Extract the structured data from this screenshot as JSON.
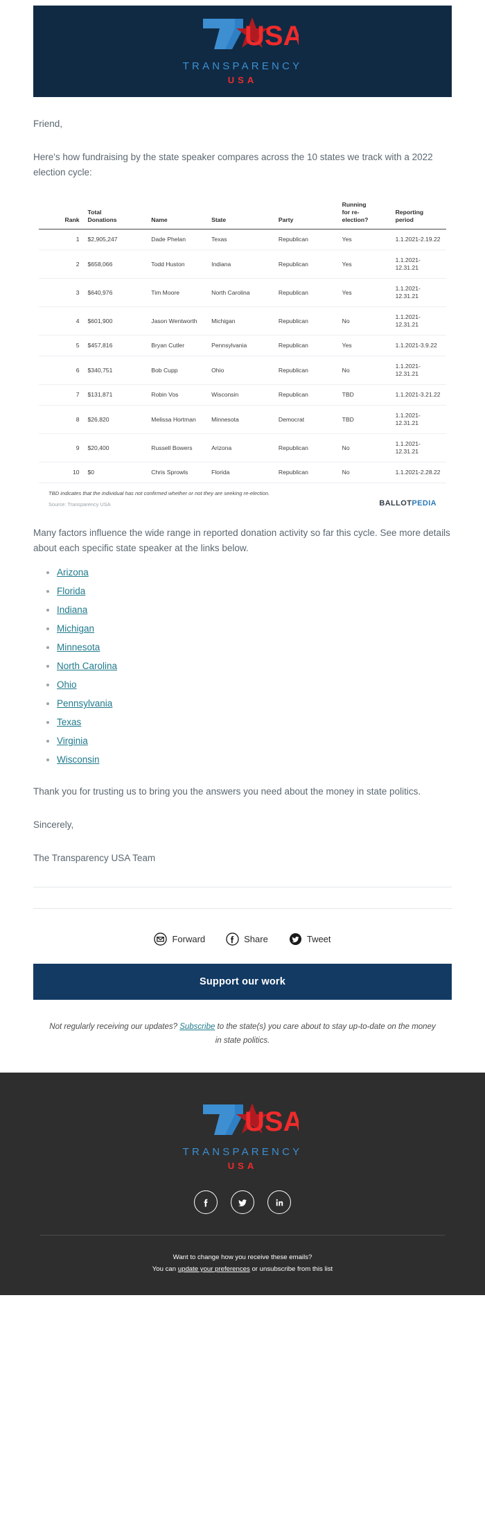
{
  "brand": {
    "name": "T USA",
    "wordmark": "TRANSPARENCY",
    "usa": "USA",
    "hero_bg": "#102a43",
    "blue": "#3d8fd1",
    "red": "#ef2b2b",
    "footer_bg": "#2e2e2e"
  },
  "body": {
    "greeting": "Friend,",
    "intro": "Here's how fundraising by the state speaker compares across the 10 states we track with a 2022 election cycle:",
    "after_table": "Many factors influence the wide range in reported donation activity so far this cycle. See more details about each specific state speaker at the links below.",
    "thanks": "Thank you for trusting us to bring you the answers you need about the money in state politics.",
    "signoff": "Sincerely,",
    "team": "The Transparency USA Team"
  },
  "table": {
    "columns": [
      "Rank",
      "Total Donations",
      "Name",
      "State",
      "Party",
      "Running for re-election?",
      "Reporting period"
    ],
    "columns_split": [
      [
        "Rank"
      ],
      [
        "Total",
        "Donations"
      ],
      [
        "Name"
      ],
      [
        "State"
      ],
      [
        "Party"
      ],
      [
        "Running",
        "for re-",
        "election?"
      ],
      [
        "Reporting",
        "period"
      ]
    ],
    "rows": [
      {
        "rank": "1",
        "amount": "$2,905,247",
        "name": "Dade Phelan",
        "state": "Texas",
        "party": "Republican",
        "reelection": "Yes",
        "period": "1.1.2021-2.19.22"
      },
      {
        "rank": "2",
        "amount": "$658,066",
        "name": "Todd Huston",
        "state": "Indiana",
        "party": "Republican",
        "reelection": "Yes",
        "period": "1.1.2021-12.31.21"
      },
      {
        "rank": "3",
        "amount": "$640,976",
        "name": "Tim Moore",
        "state": "North Carolina",
        "party": "Republican",
        "reelection": "Yes",
        "period": "1.1.2021-12.31.21"
      },
      {
        "rank": "4",
        "amount": "$601,900",
        "name": "Jason Wentworth",
        "state": "Michigan",
        "party": "Republican",
        "reelection": "No",
        "period": "1.1.2021-12.31.21"
      },
      {
        "rank": "5",
        "amount": "$457,816",
        "name": "Bryan Cutler",
        "state": "Pennsylvania",
        "party": "Republican",
        "reelection": "Yes",
        "period": "1.1.2021-3.9.22"
      },
      {
        "rank": "6",
        "amount": "$340,751",
        "name": "Bob Cupp",
        "state": "Ohio",
        "party": "Republican",
        "reelection": "No",
        "period": "1.1.2021-12.31.21"
      },
      {
        "rank": "7",
        "amount": "$131,871",
        "name": "Robin Vos",
        "state": "Wisconsin",
        "party": "Republican",
        "reelection": "TBD",
        "period": "1.1.2021-3.21.22"
      },
      {
        "rank": "8",
        "amount": "$26,820",
        "name": "Melissa Hortman",
        "state": "Minnesota",
        "party": "Democrat",
        "reelection": "TBD",
        "period": "1.1.2021-12.31.21"
      },
      {
        "rank": "9",
        "amount": "$20,400",
        "name": "Russell Bowers",
        "state": "Arizona",
        "party": "Republican",
        "reelection": "No",
        "period": "1.1.2021-12.31.21"
      },
      {
        "rank": "10",
        "amount": "$0",
        "name": "Chris Sprowls",
        "state": "Florida",
        "party": "Republican",
        "reelection": "No",
        "period": "1.1.2021-2.28.22"
      }
    ],
    "footnote": "TBD indicates that the individual has not confirmed whether or not they are seeking re-election.",
    "source": "Source: Transparency USA",
    "partner_logo": {
      "part1": "BALLOT",
      "part2": "PEDIA"
    }
  },
  "state_links": [
    "Arizona",
    "Florida",
    "Indiana",
    "Michigan",
    "Minnesota",
    "North Carolina",
    "Ohio",
    "Pennsylvania",
    "Texas",
    "Virginia",
    "Wisconsin"
  ],
  "share": [
    {
      "icon": "envelope-icon",
      "label": "Forward"
    },
    {
      "icon": "facebook-icon",
      "label": "Share"
    },
    {
      "icon": "twitter-icon",
      "label": "Tweet"
    }
  ],
  "cta": {
    "label": "Support our work",
    "bg": "#123a63"
  },
  "subscribe_note": {
    "before": "Not regularly receiving our updates? ",
    "link": "Subscribe",
    "after": " to the state(s) you care about to stay up-to-date on the money in state politics."
  },
  "footer": {
    "socials": [
      "facebook-icon",
      "twitter-icon",
      "linkedin-icon"
    ],
    "line1": "Want to change how you receive these emails?",
    "line2_before": "You can ",
    "line2_link": "update your preferences",
    "line2_after": " or unsubscribe from this list"
  }
}
